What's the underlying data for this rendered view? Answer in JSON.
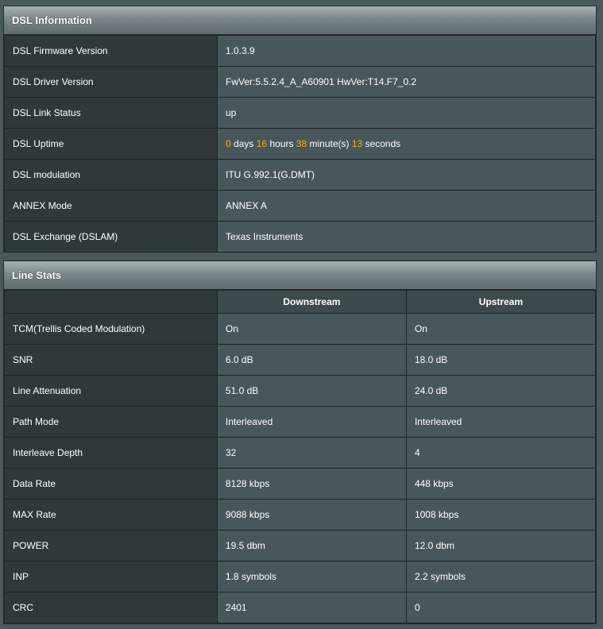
{
  "dsl_info": {
    "title": "DSL Information",
    "rows": [
      {
        "label": "DSL Firmware Version",
        "value": "1.0.3.9"
      },
      {
        "label": "DSL Driver Version",
        "value": "FwVer:5.5.2.4_A_A60901 HwVer:T14.F7_0.2"
      },
      {
        "label": "DSL Link Status",
        "value": "up"
      },
      {
        "label": "DSL Uptime",
        "value": ""
      },
      {
        "label": "DSL modulation",
        "value": "ITU G.992.1(G.DMT)"
      },
      {
        "label": "ANNEX Mode",
        "value": "ANNEX A"
      },
      {
        "label": "DSL Exchange (DSLAM)",
        "value": "Texas Instruments"
      }
    ],
    "uptime": {
      "days": "0",
      "days_unit": "days",
      "hours": "16",
      "hours_unit": "hours",
      "minutes": "38",
      "minutes_unit": "minute(s)",
      "seconds": "13",
      "seconds_unit": "seconds"
    }
  },
  "line_stats": {
    "title": "Line Stats",
    "columns": {
      "downstream": "Downstream",
      "upstream": "Upstream"
    },
    "rows": [
      {
        "label": "TCM(Trellis Coded Modulation)",
        "down": "On",
        "up": "On"
      },
      {
        "label": "SNR",
        "down": "6.0 dB",
        "up": "18.0 dB"
      },
      {
        "label": "Line Attenuation",
        "down": "51.0 dB",
        "up": "24.0 dB"
      },
      {
        "label": "Path Mode",
        "down": "Interleaved",
        "up": "Interleaved"
      },
      {
        "label": "Interleave Depth",
        "down": "32",
        "up": "4"
      },
      {
        "label": "Data Rate",
        "down": "8128 kbps",
        "up": "448 kbps"
      },
      {
        "label": "MAX Rate",
        "down": "9088 kbps",
        "up": "1008 kbps"
      },
      {
        "label": "POWER",
        "down": "19.5 dbm",
        "up": "12.0 dbm"
      },
      {
        "label": "INP",
        "down": "1.8 symbols",
        "up": "2.2 symbols"
      },
      {
        "label": "CRC",
        "down": "2401",
        "up": "0"
      }
    ]
  },
  "colors": {
    "background": "#4b585c",
    "label_cell": "#2f393c",
    "value_cell": "#47575b",
    "highlight": "#f5b400"
  }
}
